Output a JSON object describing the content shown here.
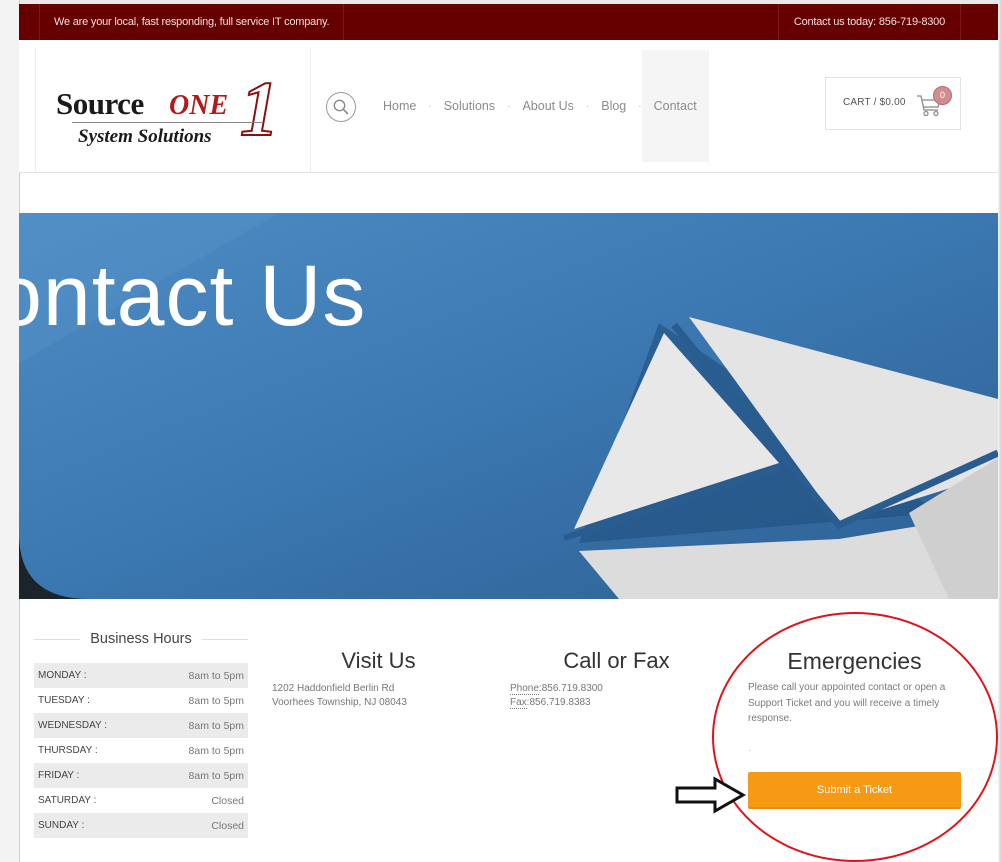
{
  "topbar": {
    "tagline": "We are your local, fast responding, full service IT company.",
    "contact": "Contact us today: 856-719-8300"
  },
  "logo": {
    "word1": "Source",
    "word2": "ONE",
    "numeral": "1",
    "subtitle": "System Solutions"
  },
  "nav": {
    "items": [
      {
        "label": "Home"
      },
      {
        "label": "Solutions"
      },
      {
        "label": "About Us"
      },
      {
        "label": "Blog"
      },
      {
        "label": "Contact",
        "active": true
      }
    ],
    "separator": "·"
  },
  "cart": {
    "label": "CART / $0.00",
    "count": "0"
  },
  "hero": {
    "title": "Contact Us"
  },
  "hours": {
    "title": "Business Hours",
    "rows": [
      {
        "day": "MONDAY :",
        "time": "8am to 5pm"
      },
      {
        "day": "TUESDAY :",
        "time": "8am to 5pm"
      },
      {
        "day": "WEDNESDAY :",
        "time": "8am to 5pm"
      },
      {
        "day": "THURSDAY :",
        "time": "8am to 5pm"
      },
      {
        "day": "FRIDAY :",
        "time": "8am to 5pm"
      },
      {
        "day": "SATURDAY :",
        "time": "Closed"
      },
      {
        "day": "SUNDAY :",
        "time": "Closed"
      }
    ]
  },
  "visit": {
    "title": "Visit Us",
    "line1": "1202 Haddonfield Berlin Rd",
    "line2": "Voorhees Township, NJ 08043"
  },
  "callfax": {
    "title": "Call or Fax",
    "phone_label": "Phone",
    "phone": ":856.719.8300",
    "fax_label": "Fax",
    "fax": ":856.719.8383"
  },
  "emergencies": {
    "title": "Emergencies",
    "text": "Please call your appointed contact or open a Support Ticket and you will receive a timely response.",
    "dot": ".",
    "button": "Submit a Ticket"
  },
  "colors": {
    "topbar": "#660000",
    "button": "#f69a15",
    "annotation": "#e0131a"
  }
}
